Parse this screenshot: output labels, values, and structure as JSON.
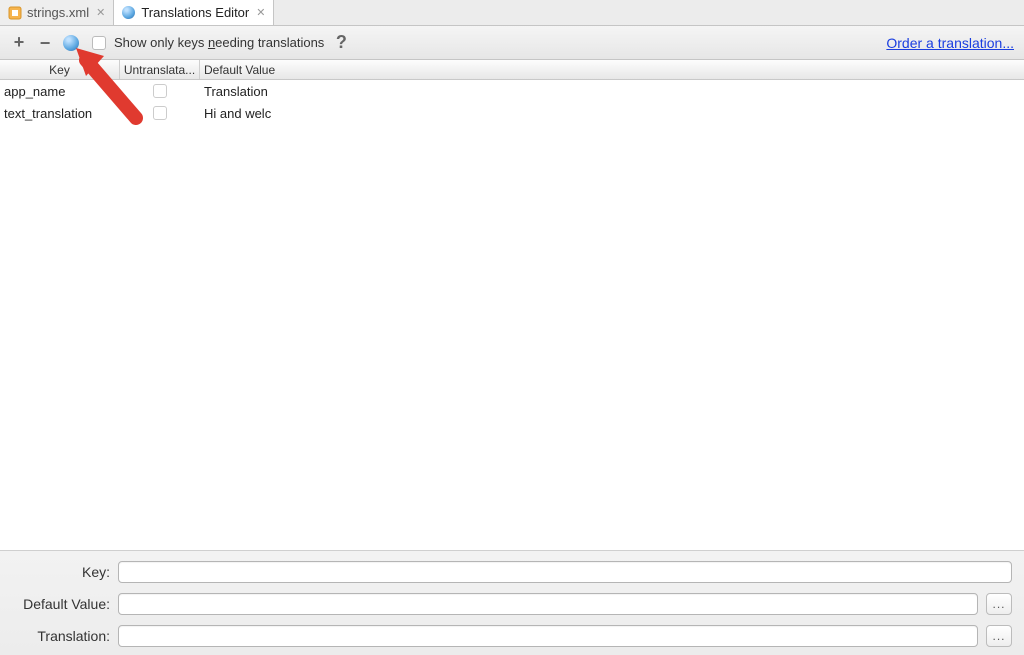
{
  "tabs": [
    {
      "label": "strings.xml",
      "icon": "xml"
    },
    {
      "label": "Translations Editor",
      "icon": "globe"
    }
  ],
  "toolbar": {
    "show_only_label": "Show only keys needing translations",
    "order_link": "Order a translation..."
  },
  "table": {
    "headers": {
      "key": "Key",
      "untranslatable": "Untranslata...",
      "default_value": "Default Value"
    },
    "rows": [
      {
        "key": "app_name",
        "default_value": "Translation"
      },
      {
        "key": "text_translation",
        "default_value": "Hi and welc"
      }
    ]
  },
  "detail": {
    "key_label": "Key:",
    "default_value_label": "Default Value:",
    "translation_label": "Translation:"
  }
}
